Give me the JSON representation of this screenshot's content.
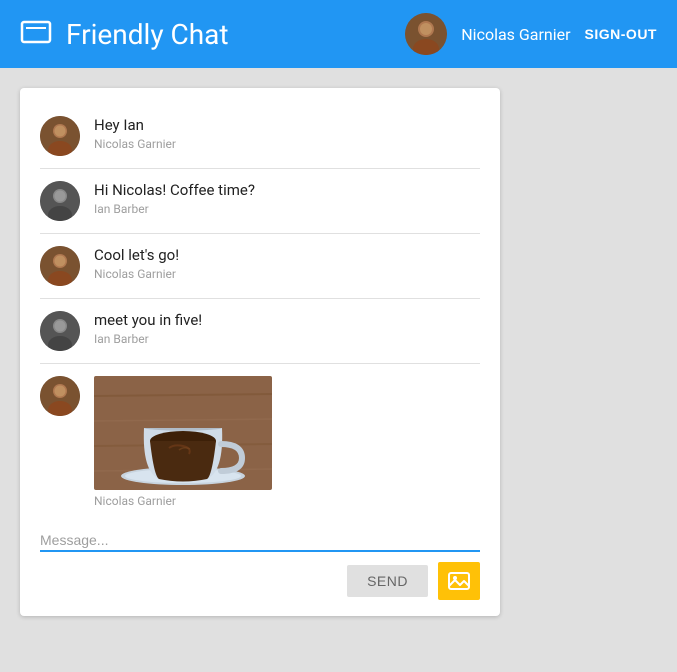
{
  "header": {
    "title": "Friendly Chat",
    "username": "Nicolas Garnier",
    "sign_out_label": "SIGN-OUT"
  },
  "messages": [
    {
      "id": 1,
      "text": "Hey Ian",
      "sender": "Nicolas Garnier",
      "avatar_type": "nicolas"
    },
    {
      "id": 2,
      "text": "Hi Nicolas! Coffee time?",
      "sender": "Ian Barber",
      "avatar_type": "ian"
    },
    {
      "id": 3,
      "text": "Cool let's go!",
      "sender": "Nicolas Garnier",
      "avatar_type": "nicolas"
    },
    {
      "id": 4,
      "text": "meet you in five!",
      "sender": "Ian Barber",
      "avatar_type": "ian"
    },
    {
      "id": 5,
      "text": "",
      "sender": "Nicolas Garnier",
      "avatar_type": "nicolas",
      "has_image": true
    }
  ],
  "input": {
    "placeholder": "Message...",
    "send_label": "SEND"
  },
  "colors": {
    "primary": "#2196F3",
    "send_bg": "#e0e0e0",
    "image_btn_bg": "#FFC107"
  }
}
